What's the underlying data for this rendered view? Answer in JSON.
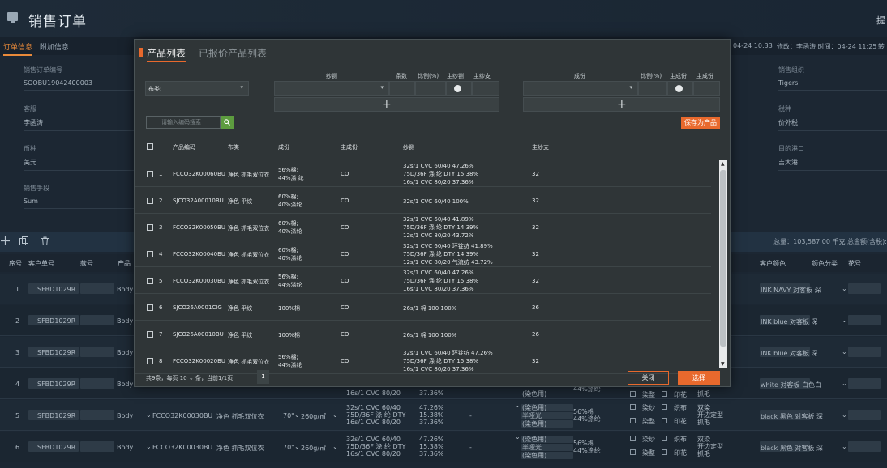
{
  "page": {
    "title": "销售订单",
    "header_right": "提",
    "tabs": [
      "订单信息",
      "附加信息"
    ],
    "meta_left": "04-24 10:33",
    "meta_right": "修改：李函涛 时间：04-24 11:25",
    "meta_edge": "转"
  },
  "fields": {
    "order_no": {
      "label": "销售订单编号",
      "value": "SOOBU19042400003"
    },
    "customer": {
      "label": "客服",
      "value": "李函涛"
    },
    "currency": {
      "label": "币种",
      "value": "美元"
    },
    "ship_mode": {
      "label": "销售手段",
      "value": "Sum"
    },
    "sales_org": {
      "label": "销售组织",
      "value": "Tigers"
    },
    "tax": {
      "label": "税种",
      "value": "价外税"
    },
    "port": {
      "label": "目的港口",
      "value": "吉大港"
    }
  },
  "toolbar": {
    "icons": [
      "plus-icon",
      "copy-icon",
      "trash-icon"
    ],
    "total": "总量：103,587.00 千克  总金额(含税):"
  },
  "grid": {
    "headers": [
      "序号",
      "客户单号",
      "款号",
      "产品",
      "客户颜色",
      "颜色分类",
      "花号"
    ],
    "rows": [
      {
        "no": "1",
        "cust_no": "SFBD1029R",
        "style": "Body",
        "color": "INK NAVY 对客板 深"
      },
      {
        "no": "2",
        "cust_no": "SFBD1029R",
        "style": "Body",
        "color": "INK blue 对客板 深"
      },
      {
        "no": "3",
        "cust_no": "SFBD1029R",
        "style": "Body",
        "color": "INK blue 对客板 深"
      },
      {
        "no": "4",
        "cust_no": "SFBD1029R",
        "style": "Body",
        "color": "white 对客板 白色白"
      },
      {
        "no": "5",
        "cust_no": "SFBD1029R",
        "style": "Body",
        "color": "black 黑色 对客板 深",
        "product": "FCCO32K00030BU",
        "name": "净色 抓毛双位衣",
        "width": "70\"",
        "weight": "260g/㎡",
        "yarn": [
          "32s/1 CVC 60/40",
          "75D/36F 涤 纶 DTY",
          "16s/1 CVC 80/20"
        ],
        "ratio": [
          "47.26%",
          "15.38%",
          "37.36%"
        ],
        "dash": "-",
        "proc": [
          "(染色用)",
          "半哑光",
          "(染色用)"
        ],
        "comp": [
          "56%棉",
          "44%涤纶"
        ],
        "opts": [
          "染纱",
          "织布",
          "染整",
          "印花"
        ],
        "finish": [
          "双染",
          "开边定型",
          "抓毛"
        ]
      },
      {
        "no": "6",
        "cust_no": "SFBD1029R",
        "style": "Body",
        "color": "black 黑色 对客板 深",
        "product": "FCCO32K00030BU",
        "name": "净色 抓毛双位衣",
        "width": "70\"",
        "weight": "260g/㎡",
        "yarn": [
          "32s/1 CVC 60/40",
          "75D/36F 涤 纶 DTY",
          "16s/1 CVC 80/20"
        ],
        "ratio": [
          "47.26%",
          "15.38%",
          "37.36%"
        ],
        "dash": "-",
        "proc": [
          "(染色用)",
          "半哑光",
          "(染色用)"
        ],
        "comp": [
          "56%棉",
          "44%涤纶"
        ],
        "opts": [
          "染纱",
          "织布",
          "染整",
          "印花"
        ],
        "finish": [
          "双染",
          "开边定型",
          "抓毛"
        ]
      }
    ],
    "row4": {
      "yarn": "16s/1 CVC 80/20",
      "ratio": "37.36%",
      "proc": "(染色用)",
      "comp": "44%涤纶",
      "opts": [
        "染整",
        "印花"
      ],
      "finish": "抓毛"
    }
  },
  "modal": {
    "tab_active": "产品列表",
    "tab_inactive": "已报价产品列表",
    "filter": {
      "category_label": "布类:",
      "group_left": {
        "yarn": "纱铡",
        "count": "条数",
        "ratio": "比例(%)",
        "main_yarn": "主纱铡",
        "main_count": "主纱支"
      },
      "group_right": {
        "comp": "成份",
        "ratio": "比例(%)",
        "main_comp": "主成份",
        "main_comp2": "主成份"
      }
    },
    "search_placeholder": "请输入编码搜索",
    "save_button": "保存为产品",
    "table": {
      "headers": {
        "code": "产品编码",
        "category": "布类",
        "comp": "成份",
        "main_comp": "主成份",
        "yarn": "纱铡",
        "main_count": "主纱支"
      },
      "rows": [
        {
          "no": "1",
          "code": "FCCO32K00060BU",
          "cat": "净色 抓毛双位衣",
          "comp": [
            "56%棉;",
            "44%涤 纶"
          ],
          "main": "CO",
          "yarn": [
            "32s/1 CVC 60/40 47.26%",
            "75D/36F 涤 纶 DTY 15.38%",
            "16s/1 CVC 80/20 37.36%"
          ],
          "count": "32"
        },
        {
          "no": "2",
          "code": "SJCO32A00010BU",
          "cat": "净色 平纹",
          "comp": [
            "60%棉;",
            "40%涤纶"
          ],
          "main": "CO",
          "yarn": [
            "32s/1 CVC 60/40 100%"
          ],
          "count": "32"
        },
        {
          "no": "3",
          "code": "FCCO32K00050BU",
          "cat": "净色 抓毛双位衣",
          "comp": [
            "60%棉;",
            "40%涤纶"
          ],
          "main": "CO",
          "yarn": [
            "32s/1 CVC 60/40 41.89%",
            "75D/36F 涤 纶 DTY 14.39%",
            "12s/1 CVC 80/20 43.72%"
          ],
          "count": "32"
        },
        {
          "no": "4",
          "code": "FCCO32K00040BU",
          "cat": "净色 抓毛双位衣",
          "comp": [
            "60%棉;",
            "40%涤纶"
          ],
          "main": "CO",
          "yarn": [
            "32s/1 CVC 60/40 环锭纺 41.89%",
            "75D/36F 涤 纶 DTY 14.39%",
            "12s/1 CVC 80/20 气流纺 43.72%"
          ],
          "count": "32"
        },
        {
          "no": "5",
          "code": "FCCO32K00030BU",
          "cat": "净色 抓毛双位衣",
          "comp": [
            "56%棉;",
            "44%涤纶"
          ],
          "main": "CO",
          "yarn": [
            "32s/1 CVC 60/40 47.26%",
            "75D/36F 涤 纶 DTY 15.38%",
            "16s/1 CVC 80/20 37.36%"
          ],
          "count": "32"
        },
        {
          "no": "6",
          "code": "SJCO26A0001CIG",
          "cat": "净色 平纹",
          "comp": [
            "100%棉"
          ],
          "main": "CO",
          "yarn": [
            "26s/1 棉 100 100%"
          ],
          "count": "26"
        },
        {
          "no": "7",
          "code": "SJCO26A00010BU",
          "cat": "净色 平纹",
          "comp": [
            "100%棉"
          ],
          "main": "CO",
          "yarn": [
            "26s/1 棉 100 100%"
          ],
          "count": "26"
        },
        {
          "no": "8",
          "code": "FCCO32K00020BU",
          "cat": "净色 抓毛双位衣",
          "comp": [
            "56%棉;",
            "44%涤纶"
          ],
          "main": "CO",
          "yarn": [
            "32s/1 CVC 60/40 环锭纺 47.26%",
            "75D/36F 涤 纶 DTY 15.38%",
            "16s/1 CVC 80/20 37.36%"
          ],
          "count": "32"
        }
      ]
    },
    "pager": {
      "total": "共9条，每页",
      "size": "10",
      "per": "条，当前1/1页",
      "page": "1"
    },
    "close_button": "关闭",
    "select_button": "选择"
  }
}
